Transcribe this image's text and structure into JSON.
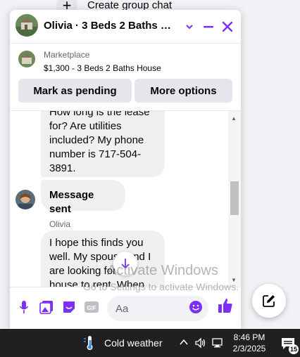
{
  "background": {
    "create_group_label": "Create group chat",
    "plus_glyph": "+"
  },
  "chat": {
    "title": "Olivia · 3 Beds 2 Baths Ho...",
    "accent_color": "#7b2ff7",
    "header_icons": [
      "chevron-down-icon",
      "minimize-icon",
      "close-icon"
    ]
  },
  "marketplace": {
    "label": "Marketplace",
    "listing": "$1,300 - 3 Beds 2 Baths House",
    "mark_pending_label": "Mark as pending",
    "more_options_label": "More options"
  },
  "messages": {
    "first_text": "How long is the lease for? Are utilities included? My phone number is 717-504-3891.",
    "status_text": "Message sent",
    "sender_name": "Olivia",
    "third_text": "I hope this finds you well. My spouse and I are looking for a house to rent. When"
  },
  "composer": {
    "placeholder": "Aa",
    "icons": [
      "microphone-icon",
      "gallery-icon",
      "sticker-icon",
      "gif-icon",
      "emoji-icon",
      "like-icon"
    ],
    "gif_label": "GIF"
  },
  "watermark": {
    "line1": "Activate Windows",
    "line2": "Go to Settings to activate Windows."
  },
  "taskbar": {
    "weather": "Cold weather",
    "time": "8:46 PM",
    "date": "2/3/2025",
    "notifications_count": "15"
  }
}
